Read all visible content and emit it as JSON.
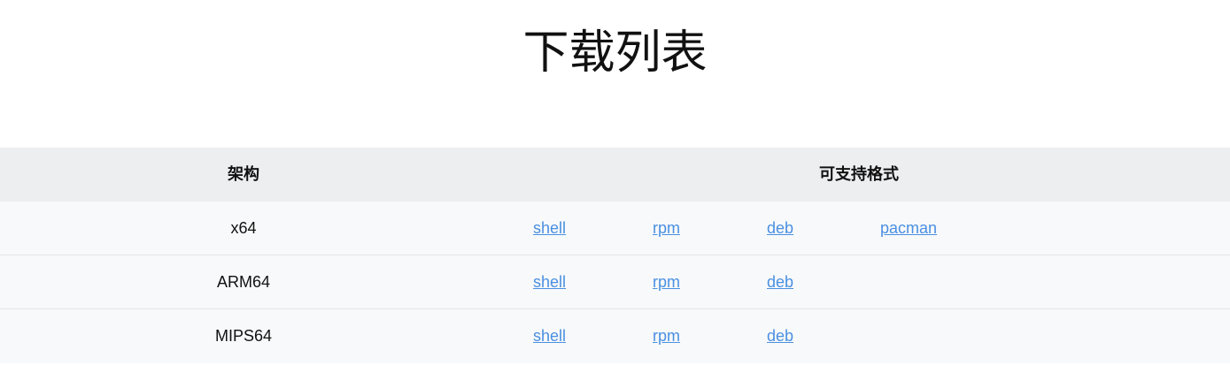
{
  "page": {
    "title": "下载列表"
  },
  "table": {
    "headers": {
      "arch": "架构",
      "formats": "可支持格式"
    },
    "rows": [
      {
        "arch": "x64",
        "formats": [
          "shell",
          "rpm",
          "deb",
          "pacman"
        ]
      },
      {
        "arch": "ARM64",
        "formats": [
          "shell",
          "rpm",
          "deb"
        ]
      },
      {
        "arch": "MIPS64",
        "formats": [
          "shell",
          "rpm",
          "deb"
        ]
      }
    ]
  },
  "colors": {
    "link": "#4a90e2",
    "header_bg": "#edeef0",
    "row_bg": "#f8f9fa",
    "divider": "#e3e5e8"
  }
}
